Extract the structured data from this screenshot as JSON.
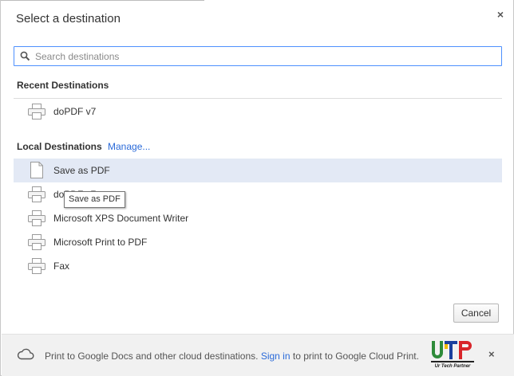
{
  "dialog": {
    "title": "Select a destination",
    "close_label": "×"
  },
  "search": {
    "placeholder": "Search destinations",
    "value": ""
  },
  "recent": {
    "title": "Recent Destinations",
    "items": [
      {
        "label": "doPDF v7",
        "icon": "printer-icon"
      }
    ]
  },
  "local": {
    "title": "Local Destinations",
    "manage_label": "Manage...",
    "items": [
      {
        "label": "Save as PDF",
        "icon": "document-icon",
        "selected": true
      },
      {
        "label": "doPDF v7",
        "icon": "printer-icon"
      },
      {
        "label": "Microsoft XPS Document Writer",
        "icon": "printer-icon"
      },
      {
        "label": "Microsoft Print to PDF",
        "icon": "printer-icon"
      },
      {
        "label": "Fax",
        "icon": "printer-icon"
      }
    ]
  },
  "tooltip": {
    "text": "Save as PDF"
  },
  "buttons": {
    "cancel_label": "Cancel"
  },
  "footer": {
    "text_before": "Print to Google Docs and other cloud destinations. ",
    "sign_in_label": "Sign in",
    "text_after": " to print to Google Cloud Print.",
    "close_label": "×"
  },
  "logo": {
    "letters": "UTP",
    "tagline": "Ur Tech Partner"
  },
  "colors": {
    "accent": "#4d90fe",
    "link": "#2a6ad9",
    "selected_row": "#e3e9f5"
  }
}
